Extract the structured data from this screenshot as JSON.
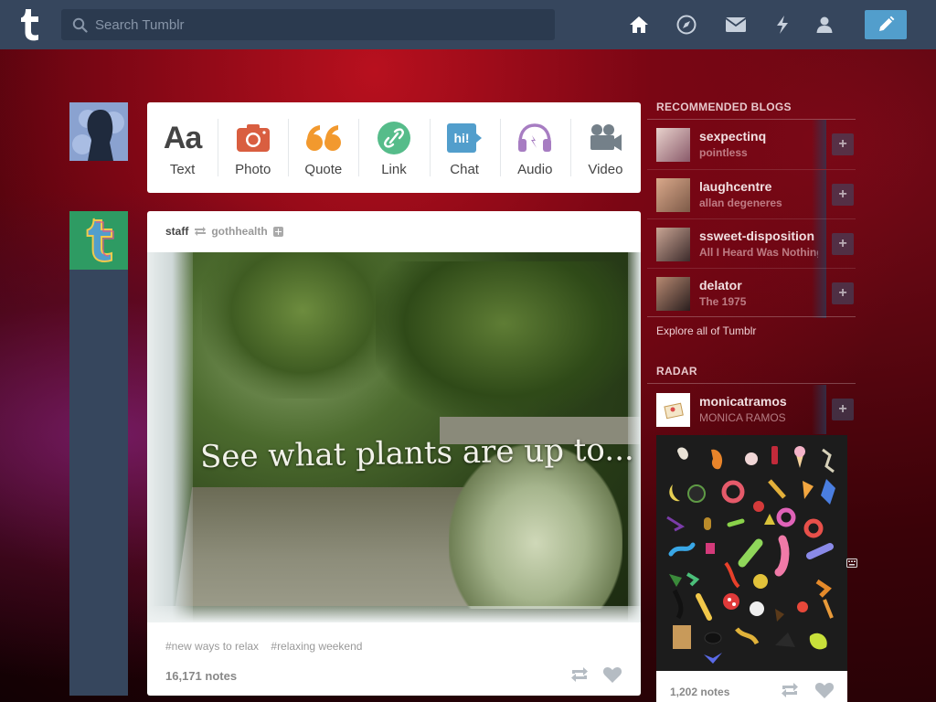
{
  "header": {
    "search_placeholder": "Search Tumblr",
    "nav": [
      "home-icon",
      "explore-icon",
      "inbox-icon",
      "activity-icon",
      "account-icon"
    ],
    "compose_icon": "pencil-icon",
    "colors": {
      "bar": "#36465d",
      "compose": "#529ecc"
    }
  },
  "post_types": [
    {
      "label": "Text",
      "glyph": "Aa",
      "color": "#444444"
    },
    {
      "label": "Photo",
      "color": "#d95e40"
    },
    {
      "label": "Quote",
      "glyph": "❝",
      "color": "#f2992e"
    },
    {
      "label": "Link",
      "color": "#56bc8a"
    },
    {
      "label": "Chat",
      "glyph": "hi!",
      "color": "#529ecc"
    },
    {
      "label": "Audio",
      "color": "#a77dc2"
    },
    {
      "label": "Video",
      "color": "#748089"
    }
  ],
  "post": {
    "author": "staff",
    "reblogged_from": "gothhealth",
    "image_caption": "See what plants are up to...",
    "tags": [
      "#new ways to relax",
      "#relaxing weekend"
    ],
    "notes": "16,171 notes"
  },
  "sidebar": {
    "recommended_title": "RECOMMENDED BLOGS",
    "blogs": [
      {
        "name": "sexpectinq",
        "subtitle": "pointless"
      },
      {
        "name": "laughcentre",
        "subtitle": "allan degeneres"
      },
      {
        "name": "ssweet-disposition",
        "subtitle": "All I Heard Was Nothing"
      },
      {
        "name": "delator",
        "subtitle": "The 1975"
      }
    ],
    "explore": "Explore all of Tumblr",
    "radar_title": "RADAR",
    "radar_blog": {
      "name": "monicatramos",
      "subtitle": "MONICA RAMOS"
    },
    "radar_notes": "1,202 notes"
  }
}
